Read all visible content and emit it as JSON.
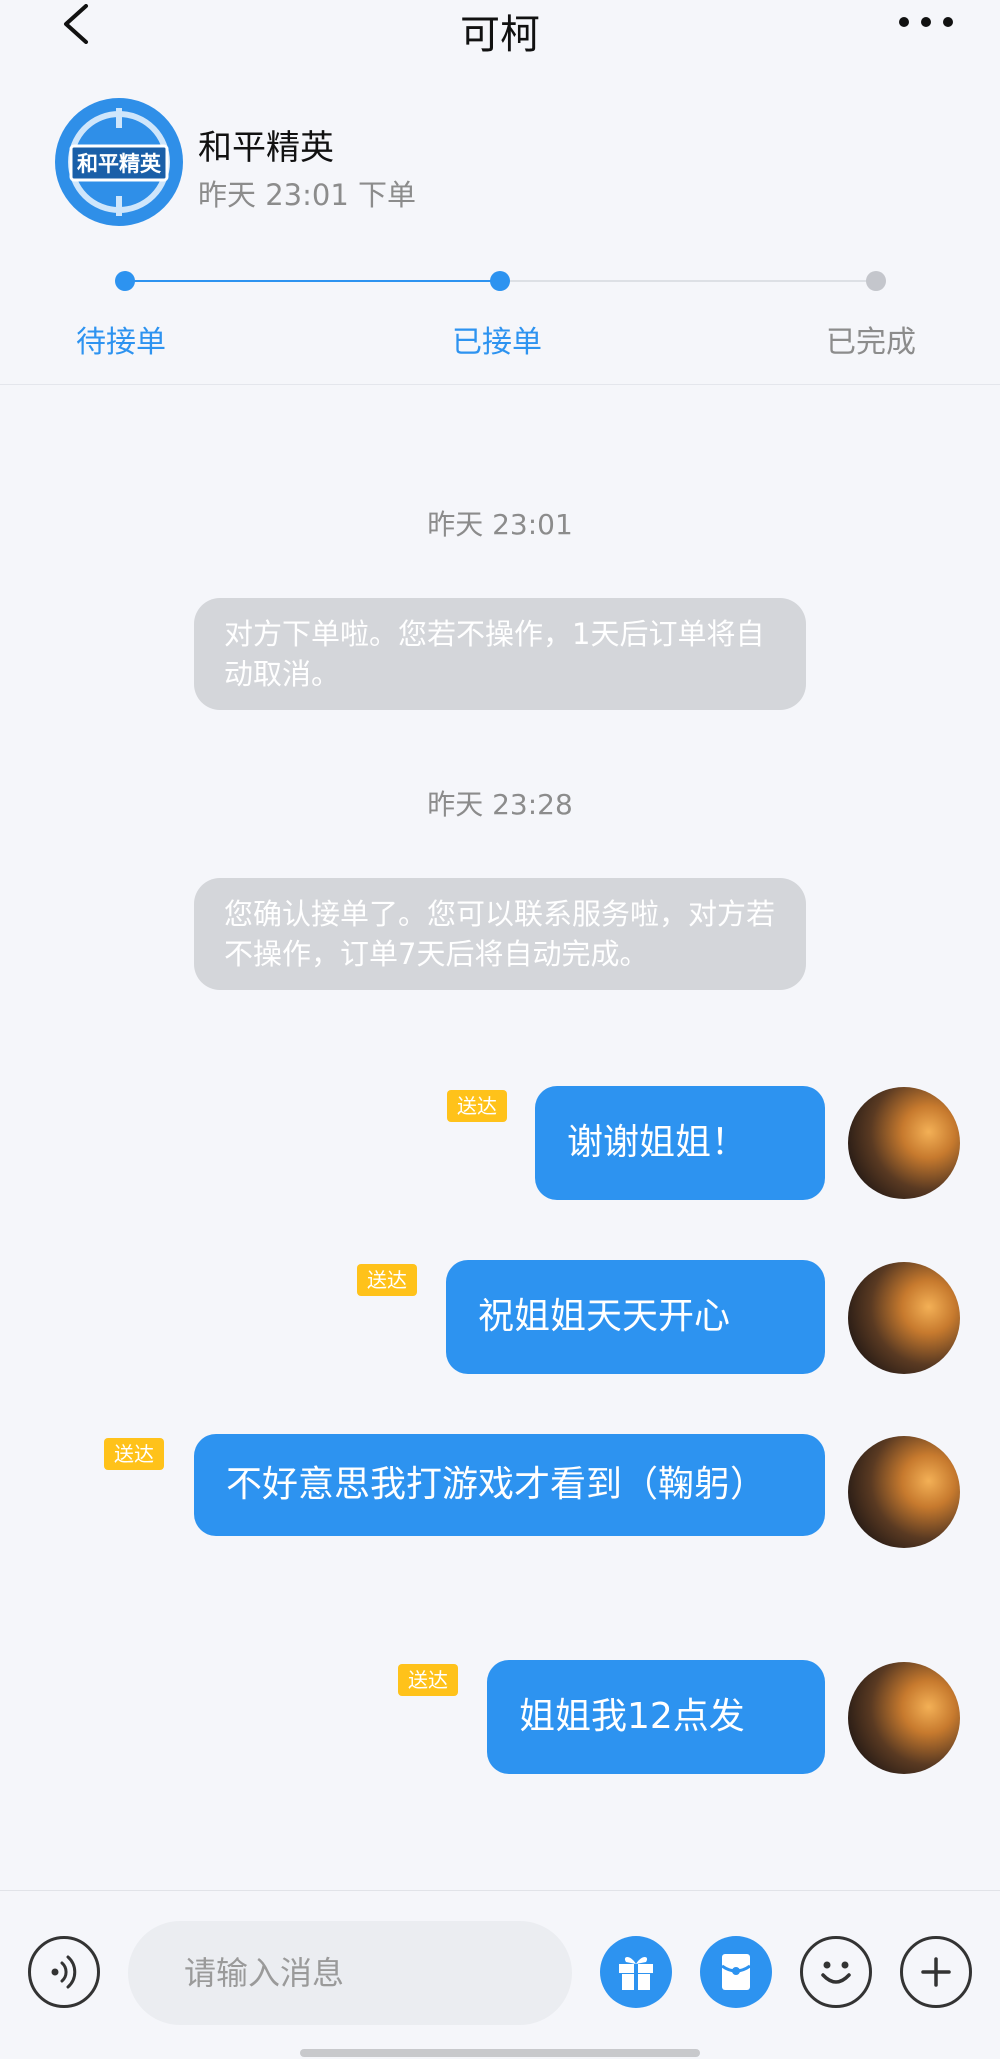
{
  "header": {
    "title": "可柯"
  },
  "order": {
    "game_name": "和平精英",
    "logo_text": "和平精英",
    "order_time": "昨天 23:01 下单",
    "steps": [
      {
        "label": "待接单",
        "state": "done"
      },
      {
        "label": "已接单",
        "state": "current"
      },
      {
        "label": "已完成",
        "state": "pending"
      }
    ]
  },
  "chat": {
    "timestamps": [
      "昨天 23:01",
      "昨天 23:28"
    ],
    "system_messages": [
      "对方下单啦。您若不操作，1天后订单将自动取消。",
      "您确认接单了。您可以联系服务啦，对方若不操作，订单7天后将自动完成。"
    ],
    "messages": [
      {
        "text": "谢谢姐姐！",
        "status": "送达"
      },
      {
        "text": "祝姐姐天天开心",
        "status": "送达"
      },
      {
        "text": "不好意思我打游戏才看到（鞠躬）",
        "status": "送达"
      },
      {
        "text": "姐姐我12点发",
        "status": "送达"
      }
    ]
  },
  "input": {
    "placeholder": "请输入消息"
  },
  "colors": {
    "accent": "#2d93f0",
    "badge": "#ffc21a",
    "system_bubble": "#d4d6da",
    "pending": "#c4c6cc"
  },
  "icons": [
    "back-icon",
    "more-icon",
    "voice-icon",
    "gift-icon",
    "red-packet-icon",
    "emoji-icon",
    "plus-icon"
  ]
}
